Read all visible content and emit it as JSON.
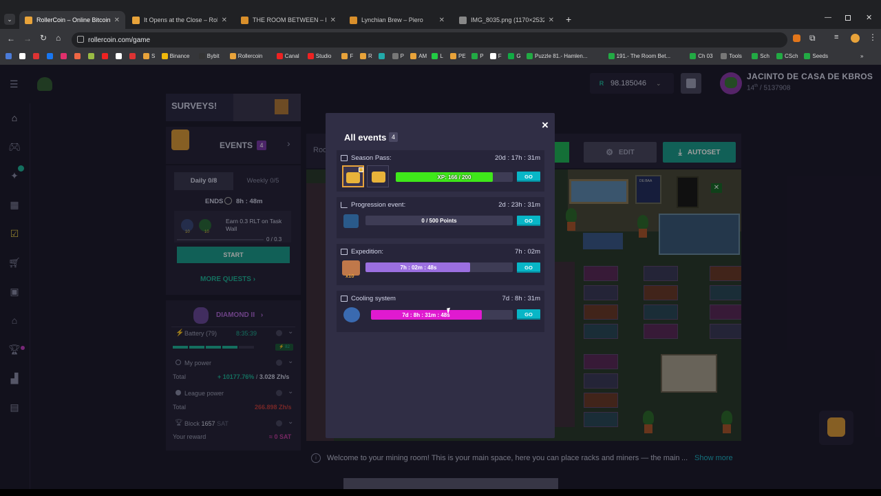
{
  "browser": {
    "tabs": [
      {
        "label": "RollerCoin – Online Bitcoin Mi",
        "fav": "#e8a33a"
      },
      {
        "label": "It Opens at the Close – RollerCo",
        "fav": "#e8a33a"
      },
      {
        "label": "THE ROOM BETWEEN – Piero",
        "fav": "#d98f2b"
      },
      {
        "label": "Lynchian Brew – Piero",
        "fav": "#d98f2b"
      },
      {
        "label": "IMG_8035.png (1170×2532)",
        "fav": "#888"
      }
    ],
    "url": "rollercoin.com/game",
    "bookmarks": [
      {
        "label": "",
        "c": "#4b7bd8"
      },
      {
        "label": "",
        "c": "#fff"
      },
      {
        "label": "",
        "c": "#d33"
      },
      {
        "label": "",
        "c": "#1877f2"
      },
      {
        "label": "",
        "c": "#e1306c"
      },
      {
        "label": "",
        "c": "#e64"
      },
      {
        "label": "",
        "c": "#9b4"
      },
      {
        "label": "",
        "c": "#e22"
      },
      {
        "label": "",
        "c": "#fff"
      },
      {
        "label": "",
        "c": "#d33"
      },
      {
        "label": "S",
        "c": "#e8a33a"
      },
      {
        "label": "Binance",
        "c": "#f0b90b"
      },
      {
        "label": "Bybit",
        "c": "#333"
      },
      {
        "label": "Rollercoin",
        "c": "#e8a33a"
      },
      {
        "label": "Canal",
        "c": "#e22"
      },
      {
        "label": "Studio",
        "c": "#e22"
      },
      {
        "label": "F",
        "c": "#e8a33a"
      },
      {
        "label": "R",
        "c": "#e8a33a"
      },
      {
        "label": "",
        "c": "#2aa"
      },
      {
        "label": "P",
        "c": "#777"
      },
      {
        "label": "AM",
        "c": "#e8a33a"
      },
      {
        "label": "L",
        "c": "#2c4"
      },
      {
        "label": "PE",
        "c": "#e8a33a"
      },
      {
        "label": "P",
        "c": "#2a4"
      },
      {
        "label": "F",
        "c": "#fff"
      },
      {
        "label": "G",
        "c": "#1a4"
      },
      {
        "label": "Puzzle 81.- Hamlen...",
        "c": "#2a4"
      },
      {
        "label": "191.- The Room Bet...",
        "c": "#2a4"
      },
      {
        "label": "Ch 03",
        "c": "#2a4"
      },
      {
        "label": "Tools",
        "c": "#777"
      },
      {
        "label": "Sch",
        "c": "#2a4"
      },
      {
        "label": "CSch",
        "c": "#2a4"
      },
      {
        "label": "Seeds",
        "c": "#2a4"
      }
    ]
  },
  "header": {
    "balance": "98.185046",
    "currency_letter": "R",
    "username": "JACINTO DE CASA DE KBROS",
    "rank": "14",
    "rank_suffix": "th",
    "rank_total": "/ 5137908"
  },
  "left": {
    "surveys": "SURVEYS!",
    "events_label": "EVENTS",
    "events_count": "4",
    "tab_daily": "Daily 0/8",
    "tab_weekly": "Weekly 0/5",
    "ends_label": "ENDS",
    "ends_time": "8h : 48m",
    "quest_text": "Earn 0.3 RLT on Task Wall",
    "quest_progress_text": "0 / 0.3",
    "quest_badge_a": "10",
    "quest_badge_b": "10",
    "start_label": "START",
    "more_quests": "MORE QUESTS",
    "league": "DIAMOND II",
    "battery_label": "Battery (79)",
    "battery_time": "8:35:39",
    "battery_badge": "⚡ 82",
    "battery_fraction": 0.79,
    "my_power": "My power",
    "total_label": "Total",
    "power_pct": "+ 10177.76%",
    "power_sep": "/",
    "power_val": "3.028 Zh/s",
    "league_power": "League power",
    "league_total": "266.898 Zh/s",
    "block_label": "Block",
    "block_num": "1657",
    "block_unit": "SAT",
    "reward_label": "Your reward",
    "reward_val": "≈ 0 SAT"
  },
  "room": {
    "tab_partial": "Roo",
    "edit": "EDIT",
    "autoset": "AUTOSET",
    "screen_text": "DE:BAA",
    "welcome": "Welcome to your mining room! This is your main space, here you can place racks and miners — the main",
    "ellipsis": "...",
    "show_more": "Show more"
  },
  "modal": {
    "title": "All events",
    "count": "4",
    "close": "×",
    "events": [
      {
        "name": "Season Pass:",
        "time": "20d : 17h : 31m",
        "bar": "XP: 166 / 200",
        "fraction": 0.83,
        "color": "#3fe81a",
        "go": "GO"
      },
      {
        "name": "Progression event:",
        "time": "2d : 23h : 31m",
        "bar": "0 / 500 Points",
        "fraction": 0,
        "color": "#3fe81a",
        "go": "GO"
      },
      {
        "name": "Expedition:",
        "time": "7h : 02m",
        "bar": "7h : 02m : 48s",
        "fraction": 0.71,
        "color": "#9b6fe0",
        "go": "GO",
        "badge": "x10"
      },
      {
        "name": "Cooling system",
        "time": "7d : 8h : 31m",
        "bar": "7d : 8h : 31m : 48s",
        "fraction": 0.78,
        "color": "#e01ad0",
        "go": "GO"
      }
    ]
  }
}
